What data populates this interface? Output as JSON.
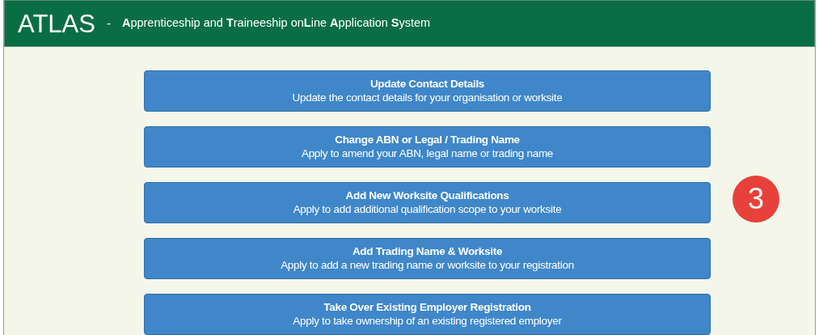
{
  "header": {
    "logo": "ATLAS",
    "separator": "-",
    "subtitle": "**A**pprenticeship and **T**raineeship on**L**ine **A**pplication **S**ystem"
  },
  "actions": [
    {
      "title": "Update Contact Details",
      "description": "Update the contact details for your organisation or worksite"
    },
    {
      "title": "Change ABN or Legal / Trading Name",
      "description": "Apply to amend your ABN, legal name or trading name"
    },
    {
      "title": "Add New Worksite Qualifications",
      "description": "Apply to add additional qualification scope to your worksite"
    },
    {
      "title": "Add Trading Name & Worksite",
      "description": "Apply to add a new trading name or worksite to your registration"
    },
    {
      "title": "Take Over Existing Employer Registration",
      "description": "Apply to take ownership of an existing registered employer"
    }
  ],
  "annotation": {
    "label": "3",
    "color": "#e8403a"
  }
}
